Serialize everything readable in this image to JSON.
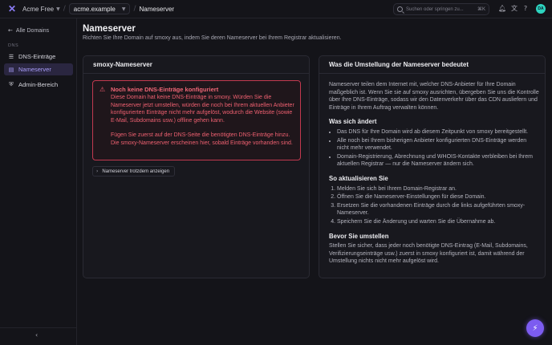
{
  "topbar": {
    "org_name": "Acme Free",
    "domain_value": "acme.example",
    "page_crumb": "Nameserver",
    "search_placeholder": "Suchen oder springen zu...",
    "search_shortcut": "⌘K",
    "avatar_initials": "DA"
  },
  "sidebar": {
    "back_label": "Alle Domains",
    "section_label": "DNS",
    "items": [
      {
        "label": "DNS-Einträge",
        "active": false
      },
      {
        "label": "Nameserver",
        "active": true
      },
      {
        "label": "Admin-Bereich",
        "active": false
      }
    ]
  },
  "header": {
    "title": "Nameserver",
    "subtitle": "Richten Sie Ihre Domain auf smoxy aus, indem Sie deren Nameserver bei Ihrem Registrar aktualisieren."
  },
  "left_card": {
    "title": "smoxy-Nameserver",
    "alert_title": "Noch keine DNS-Einträge konfiguriert",
    "alert_p1": "Diese Domain hat keine DNS-Einträge in smoxy. Würden Sie die Nameserver jetzt umstellen, würden die noch bei Ihrem aktuellen Anbieter konfigurierten Einträge nicht mehr aufgelöst, wodurch die Website (sowie E-Mail, Subdomains usw.) offline gehen kann.",
    "alert_p2": "Fügen Sie zuerst auf der DNS-Seite die benötigten DNS-Einträge hinzu. Die smoxy-Nameserver erscheinen hier, sobald Einträge vorhanden sind.",
    "show_button": "Nameserver trotzdem anzeigen"
  },
  "right_card": {
    "title": "Was die Umstellung der Nameserver bedeutet",
    "intro": "Nameserver teilen dem Internet mit, welcher DNS-Anbieter für Ihre Domain maßgeblich ist. Wenn Sie sie auf smoxy ausrichten, übergeben Sie uns die Kontrolle über Ihre DNS-Einträge, sodass wir den Datenverkehr über das CDN ausliefern und Einträge in Ihrem Auftrag verwalten können.",
    "changes_heading": "Was sich ändert",
    "changes": [
      "Das DNS für Ihre Domain wird ab diesem Zeitpunkt von smoxy bereitgestellt.",
      "Alle noch bei Ihrem bisherigen Anbieter konfigurierten DNS-Einträge werden nicht mehr verwendet.",
      "Domain-Registrierung, Abrechnung und WHOIS-Kontakte verbleiben bei Ihrem aktuellen Registrar — nur die Nameserver ändern sich."
    ],
    "steps_heading": "So aktualisieren Sie",
    "steps": [
      "Melden Sie sich bei Ihrem Domain-Registrar an.",
      "Öffnen Sie die Nameserver-Einstellungen für diese Domain.",
      "Ersetzen Sie die vorhandenen Einträge durch die links aufgeführten smoxy-Nameserver.",
      "Speichern Sie die Änderung und warten Sie die Übernahme ab."
    ],
    "before_heading": "Bevor Sie umstellen",
    "before_text": "Stellen Sie sicher, dass jeder noch benötigte DNS-Eintrag (E-Mail, Subdomains, Verifizierungseinträge usw.) zuerst in smoxy konfiguriert ist, damit während der Umstellung nichts nicht mehr aufgelöst wird."
  },
  "colors": {
    "accent": "#8b7cf6",
    "danger": "#ef5b6e",
    "avatar": "#2dd4bf",
    "fab": "#7c5cf0"
  }
}
